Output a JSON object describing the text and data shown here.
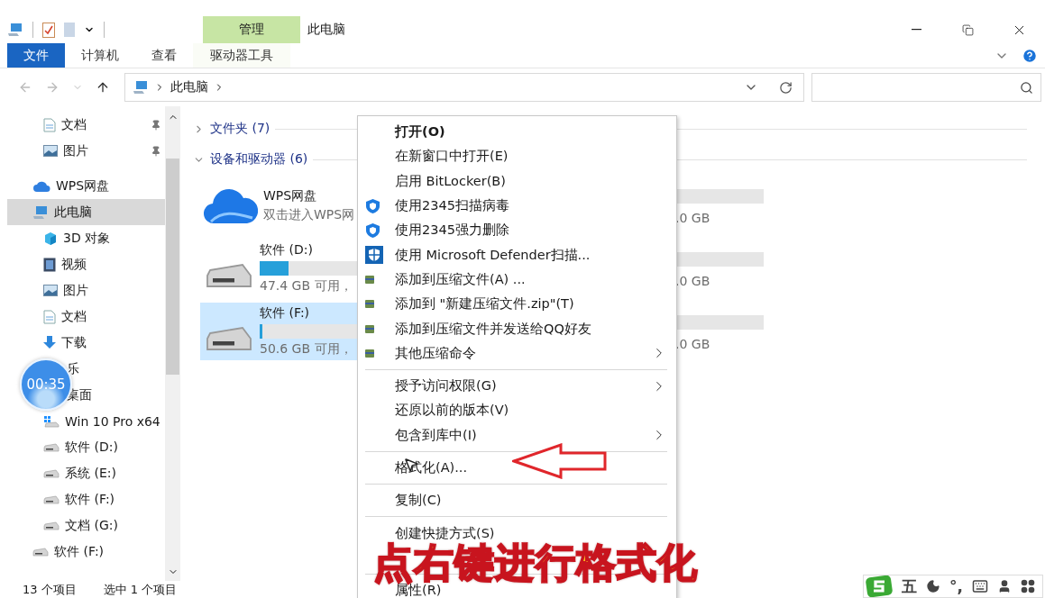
{
  "title_bar": {
    "context_tab": "管理",
    "title": "此电脑"
  },
  "ribbon": {
    "tabs": [
      {
        "label": "文件",
        "selected": true,
        "kind": "file"
      },
      {
        "label": "计算机",
        "selected": false,
        "kind": "normal"
      },
      {
        "label": "查看",
        "selected": false,
        "kind": "normal"
      },
      {
        "label": "驱动器工具",
        "selected": false,
        "kind": "context"
      }
    ]
  },
  "address": {
    "path": [
      "此电脑"
    ]
  },
  "sidebar": {
    "pinned_items": [
      {
        "label": "文档",
        "kind": "document"
      },
      {
        "label": "图片",
        "kind": "picture"
      }
    ],
    "items": [
      {
        "label": "WPS网盘",
        "kind": "cloud",
        "selected": false
      },
      {
        "label": "此电脑",
        "kind": "pc",
        "selected": true,
        "children": [
          {
            "label": "3D 对象",
            "kind": "cube",
            "selected": false
          },
          {
            "label": "视频",
            "kind": "video",
            "selected": false
          },
          {
            "label": "图片",
            "kind": "picture",
            "selected": false
          },
          {
            "label": "文档",
            "kind": "document",
            "selected": false
          },
          {
            "label": "下载",
            "kind": "download",
            "selected": false
          },
          {
            "label": "乐",
            "kind": "covered",
            "selected": false
          },
          {
            "label": "桌面",
            "kind": "covered",
            "selected": false
          },
          {
            "label": "Win 10 Pro x64",
            "kind": "windrive",
            "selected": false
          },
          {
            "label": "软件 (D:)",
            "kind": "drive",
            "selected": false
          },
          {
            "label": "系统 (E:)",
            "kind": "drive",
            "selected": false
          },
          {
            "label": "软件 (F:)",
            "kind": "drive",
            "selected": false
          },
          {
            "label": "文档 (G:)",
            "kind": "drive",
            "selected": false
          }
        ]
      },
      {
        "label": "软件 (F:)",
        "kind": "drive",
        "selected": false
      }
    ]
  },
  "content": {
    "groups": [
      {
        "label": "文件夹 (7)",
        "expanded": false
      },
      {
        "label": "设备和驱动器 (6)",
        "expanded": true
      }
    ],
    "tiles": [
      {
        "kind": "cloud",
        "name": "WPS网盘",
        "detail": "双击进入WPS网",
        "selected": false
      },
      {
        "kind": "drive",
        "name": "软件 (D:)",
        "level": 0.12,
        "detail": "47.4 GB 可用，",
        "selected": false
      },
      {
        "kind": "drive",
        "name": "软件 (F:)",
        "level": 0.01,
        "detail": "50.6 GB 可用，",
        "selected": true
      }
    ],
    "column_2_tiles": [
      {
        "size_text": ".0 GB"
      },
      {
        "size_text": ".0 GB"
      },
      {
        "size_text": ".0 GB"
      }
    ]
  },
  "context_menu": {
    "items": [
      {
        "kind": "item",
        "label": "打开(O)",
        "default": true,
        "submenu": false
      },
      {
        "kind": "item",
        "label": "在新窗口中打开(E)",
        "default": false,
        "submenu": false
      },
      {
        "kind": "item",
        "label": "启用 BitLocker(B)",
        "default": false,
        "submenu": false
      },
      {
        "kind": "shield_item",
        "label": "使用2345扫描病毒",
        "default": false,
        "submenu": false
      },
      {
        "kind": "shield_item",
        "label": "使用2345强力删除",
        "default": false,
        "submenu": false
      },
      {
        "kind": "defender_item",
        "label": "使用 Microsoft Defender扫描...",
        "default": false,
        "submenu": false
      },
      {
        "kind": "archive_item",
        "label": "添加到压缩文件(A) ...",
        "default": false,
        "submenu": false
      },
      {
        "kind": "archive_item",
        "label": "添加到 \"新建压缩文件.zip\"(T)",
        "default": false,
        "submenu": false
      },
      {
        "kind": "archive_item",
        "label": "添加到压缩文件并发送给QQ好友",
        "default": false,
        "submenu": false
      },
      {
        "kind": "archive_item",
        "label": "其他压缩命令",
        "default": false,
        "submenu": true
      },
      {
        "kind": "separator"
      },
      {
        "kind": "item",
        "label": "授予访问权限(G)",
        "default": false,
        "submenu": true
      },
      {
        "kind": "item",
        "label": "还原以前的版本(V)",
        "default": false,
        "submenu": false
      },
      {
        "kind": "item",
        "label": "包含到库中(I)",
        "default": false,
        "submenu": true
      },
      {
        "kind": "separator"
      },
      {
        "kind": "item",
        "label": "格式化(A)...",
        "default": false,
        "submenu": false
      },
      {
        "kind": "separator"
      },
      {
        "kind": "item",
        "label": "复制(C)",
        "default": false,
        "submenu": false
      },
      {
        "kind": "separator"
      },
      {
        "kind": "item",
        "label": "创建快捷方式(S)",
        "default": false,
        "submenu": false
      },
      {
        "kind": "gap"
      },
      {
        "kind": "separator"
      },
      {
        "kind": "item",
        "label": "属性(R)",
        "default": false,
        "submenu": false
      }
    ]
  },
  "overlays": {
    "caption": "点右键进行格式化",
    "timer": "00:35"
  },
  "status_bar": {
    "item_count": "13 个项目",
    "selection": "选中 1 个项目"
  },
  "ime_bar": {
    "mode": "五",
    "punctuation": "°,"
  }
}
